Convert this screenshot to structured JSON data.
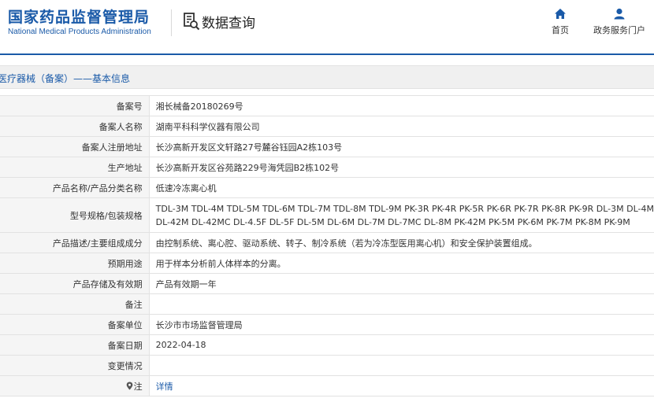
{
  "header": {
    "logo_cn": "国家药品监督管理局",
    "logo_en": "National Medical Products Administration",
    "query_title": "数据查询",
    "nav": {
      "home": "首页",
      "portal": "政务服务门户"
    }
  },
  "breadcrumb": "医疗器械（备案）——基本信息",
  "rows": [
    {
      "label": "备案号",
      "value": "湘长械备20180269号"
    },
    {
      "label": "备案人名称",
      "value": "湖南平科科学仪器有限公司"
    },
    {
      "label": "备案人注册地址",
      "value": "长沙高新开发区文轩路27号麓谷钰园A2栋103号"
    },
    {
      "label": "生产地址",
      "value": "长沙高新开发区谷苑路229号海凭园B2栋102号"
    },
    {
      "label": "产品名称/产品分类名称",
      "value": "低速冷冻离心机"
    },
    {
      "label": "型号规格/包装规格",
      "value_line1": "TDL-3M TDL-4M TDL-5M TDL-6M TDL-7M TDL-8M TDL-9M PK-3R PK-4R PK-5R PK-6R PK-7R PK-8R PK-9R DL-3M DL-4M",
      "value_line2": "DL-42M DL-42MC DL-4.5F DL-5F DL-5M DL-6M DL-7M DL-7MC DL-8M PK-42M PK-5M PK-6M PK-7M PK-8M PK-9M"
    },
    {
      "label": "产品描述/主要组成成分",
      "value": "由控制系统、离心腔、驱动系统、转子、制冷系统（若为冷冻型医用离心机）和安全保护装置组成。"
    },
    {
      "label": "预期用途",
      "value": "用于样本分析前人体样本的分离。"
    },
    {
      "label": "产品存储及有效期",
      "value": "产品有效期一年"
    },
    {
      "label": "备注",
      "value": ""
    },
    {
      "label": "备案单位",
      "value": "长沙市市场监督管理局"
    },
    {
      "label": "备案日期",
      "value": "2022-04-18"
    },
    {
      "label": "变更情况",
      "value": ""
    },
    {
      "label": "注",
      "value": "详情"
    }
  ],
  "colors": {
    "brand_blue": "#1a5aa8",
    "label_bg": "#f5f5f5",
    "border": "#e2e2e2"
  },
  "icons": {
    "query": "search-document-icon",
    "home": "home-icon",
    "portal": "user-icon",
    "note": "map-pin-icon"
  }
}
